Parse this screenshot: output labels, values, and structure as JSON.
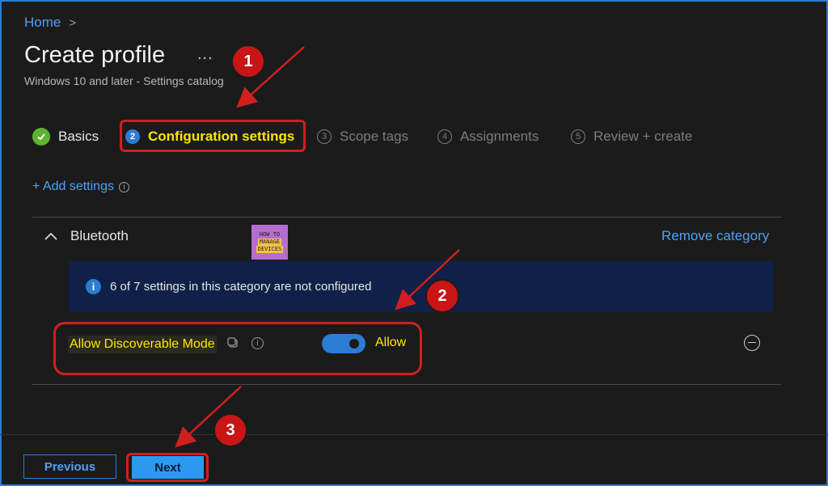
{
  "breadcrumb": {
    "home": "Home",
    "chevron": ">"
  },
  "header": {
    "title": "Create profile",
    "more": "...",
    "subtitle": "Windows 10 and later - Settings catalog"
  },
  "steps": [
    {
      "label": "Basics",
      "state": "done"
    },
    {
      "num": "2",
      "label": "Configuration settings",
      "state": "active"
    },
    {
      "num": "3",
      "label": "Scope tags",
      "state": "pending"
    },
    {
      "num": "4",
      "label": "Assignments",
      "state": "pending"
    },
    {
      "num": "5",
      "label": "Review + create",
      "state": "pending"
    }
  ],
  "add_settings": {
    "label": "+ Add settings",
    "info": "i"
  },
  "category": {
    "chevron": "^",
    "name": "Bluetooth",
    "remove_label": "Remove category",
    "banner_icon": "i",
    "banner_text": "6 of 7 settings in this category are not configured"
  },
  "watermark": {
    "line1": "HOW TO",
    "line2": "MANAGE",
    "line3": "DEVICES"
  },
  "setting": {
    "label": "Allow Discoverable Mode",
    "toggle_on": true,
    "value_label": "Allow",
    "info": "i"
  },
  "footer": {
    "previous_label": "Previous",
    "next_label": "Next"
  },
  "callouts": [
    "1",
    "2",
    "3"
  ],
  "colors": {
    "accent": "#2b7cd3",
    "highlight_text": "#ffe600",
    "annotation_red": "#d11f1f",
    "success": "#5db52f"
  },
  "icons": [
    "check-icon",
    "info-icon",
    "copy-icon",
    "remove-icon",
    "chevron-up-icon"
  ]
}
